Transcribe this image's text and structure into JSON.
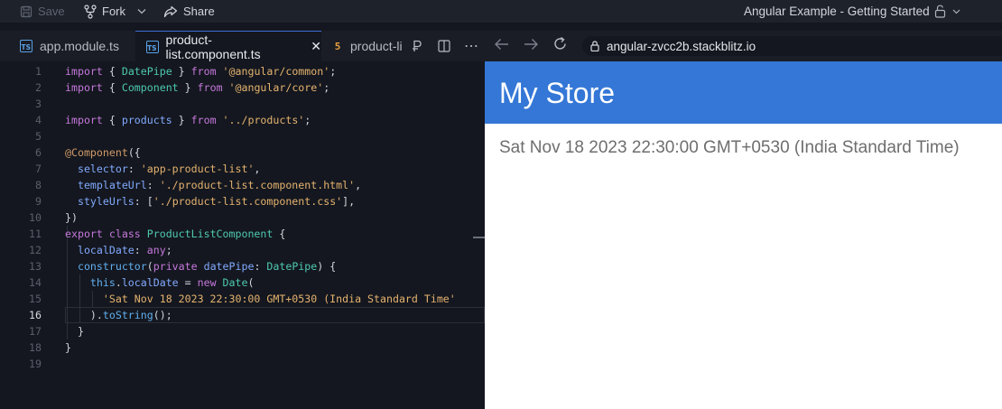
{
  "topbar": {
    "save_label": "Save",
    "fork_label": "Fork",
    "share_label": "Share",
    "project_title": "Angular Example - Getting Started"
  },
  "tabs": [
    {
      "label": "app.module.ts",
      "icon": "ts-file-icon",
      "active": false
    },
    {
      "label": "product-list.component.ts",
      "icon": "ts-file-icon",
      "active": true
    },
    {
      "label": "product-li",
      "icon": "html-file-icon",
      "active": false
    }
  ],
  "browser": {
    "url": "angular-zvcc2b.stackblitz.io"
  },
  "editor": {
    "current_line": 16,
    "lines": [
      "import { DatePipe } from '@angular/common';",
      "import { Component } from '@angular/core';",
      "",
      "import { products } from '../products';",
      "",
      "@Component({",
      "  selector: 'app-product-list',",
      "  templateUrl: './product-list.component.html',",
      "  styleUrls: ['./product-list.component.css'],",
      "})",
      "export class ProductListComponent {",
      "  localDate: any;",
      "  constructor(private datePipe: DatePipe) {",
      "    this.localDate = new Date(",
      "      'Sat Nov 18 2023 22:30:00 GMT+0530 (India Standard Time'",
      "    ).toString();",
      "  }",
      "}",
      ""
    ]
  },
  "preview": {
    "store_title": "My Store",
    "date_text": "Sat Nov 18 2023 22:30:00 GMT+0530 (India Standard Time)"
  },
  "colors": {
    "header_blue": "#3477d6",
    "editor_bg": "#14171f",
    "tab_accent": "#3b6fd6"
  }
}
